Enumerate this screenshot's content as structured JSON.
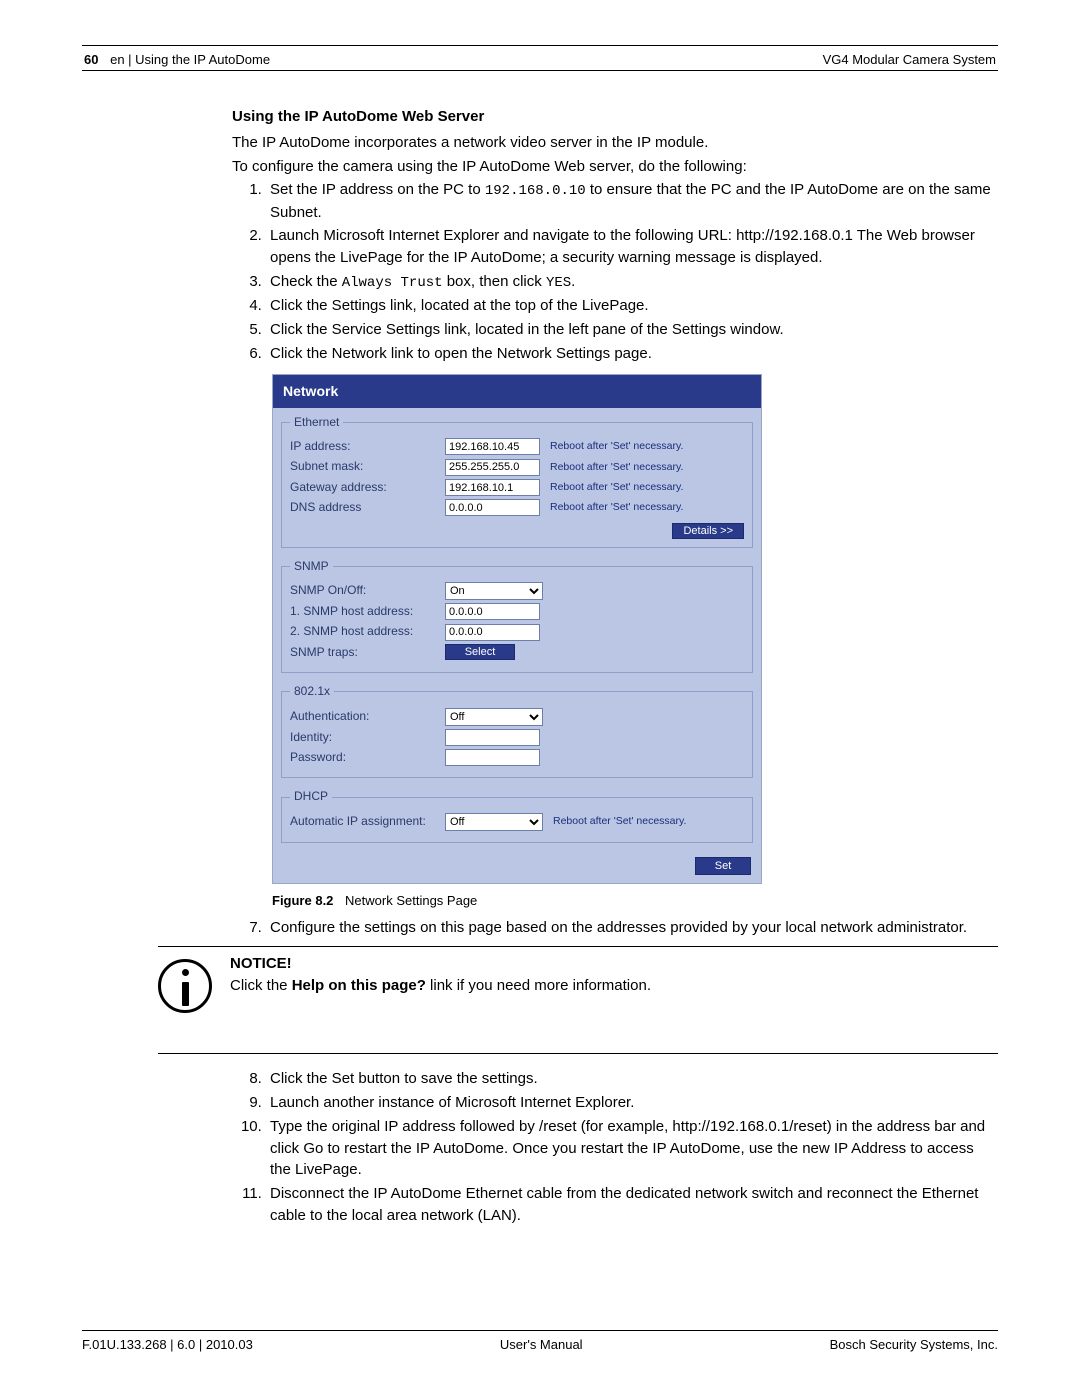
{
  "header": {
    "page_number": "60",
    "breadcrumb": "en | Using the IP AutoDome",
    "system_name": "VG4 Modular Camera System"
  },
  "body": {
    "section_title": "Using the IP AutoDome Web Server",
    "intro1": "The IP AutoDome incorporates a network video server in the IP module.",
    "intro2": "To configure the camera using the IP AutoDome Web server, do the following:",
    "steps_a": [
      {
        "pre": "Set the IP address on the PC to ",
        "code": "192.168.0.10",
        "post": " to ensure that the PC and the IP AutoDome are on the same Subnet."
      },
      {
        "text": "Launch Microsoft Internet Explorer and navigate to the following URL: http://192.168.0.1 The Web browser opens the LivePage for the IP AutoDome; a security warning message is displayed."
      },
      {
        "pre": "Check the ",
        "code": "Always Trust",
        "mid": " box, then click ",
        "code2": "YES",
        "post": "."
      },
      {
        "text": "Click the Settings link, located at the top of the LivePage."
      },
      {
        "text": "Click the Service Settings link, located in the left pane of the Settings window."
      },
      {
        "text": "Click the Network link to open the Network Settings page."
      }
    ],
    "step7": "Configure the settings on this page based on the addresses provided by your local network administrator.",
    "steps_b_start": 8,
    "steps_b": [
      "Click the Set button to save the settings.",
      "Launch another instance of Microsoft Internet Explorer.",
      "Type the original IP address followed by /reset (for example, http://192.168.0.1/reset) in the address bar and click Go to restart the IP AutoDome. Once you restart the IP AutoDome, use the new IP Address to access the LivePage.",
      "Disconnect the IP AutoDome Ethernet cable from the dedicated network switch and reconnect the Ethernet cable to the local area network (LAN)."
    ]
  },
  "figure": {
    "title": "Network",
    "reboot_note": "Reboot after 'Set' necessary.",
    "ethernet": {
      "legend": "Ethernet",
      "ip_label": "IP address:",
      "ip_value": "192.168.10.45",
      "subnet_label": "Subnet mask:",
      "subnet_value": "255.255.255.0",
      "gateway_label": "Gateway address:",
      "gateway_value": "192.168.10.1",
      "dns_label": "DNS address",
      "dns_value": "0.0.0.0",
      "details_btn": "Details >>"
    },
    "snmp": {
      "legend": "SNMP",
      "onoff_label": "SNMP On/Off:",
      "onoff_value": "On",
      "host1_label": "1. SNMP host address:",
      "host1_value": "0.0.0.0",
      "host2_label": "2. SNMP host address:",
      "host2_value": "0.0.0.0",
      "traps_label": "SNMP traps:",
      "select_btn": "Select"
    },
    "x8021": {
      "legend": "802.1x",
      "auth_label": "Authentication:",
      "auth_value": "Off",
      "identity_label": "Identity:",
      "identity_value": "",
      "password_label": "Password:",
      "password_value": ""
    },
    "dhcp": {
      "legend": "DHCP",
      "auto_label": "Automatic IP assignment:",
      "auto_value": "Off"
    },
    "set_btn": "Set",
    "caption_label": "Figure 8.2",
    "caption_text": "Network Settings Page"
  },
  "notice": {
    "title": "NOTICE!",
    "pre": "Click the ",
    "bold": "Help on this page?",
    "post": " link if you need more information."
  },
  "footer": {
    "left": "F.01U.133.268 | 6.0 | 2010.03",
    "center": "User's Manual",
    "right": "Bosch Security Systems, Inc."
  }
}
